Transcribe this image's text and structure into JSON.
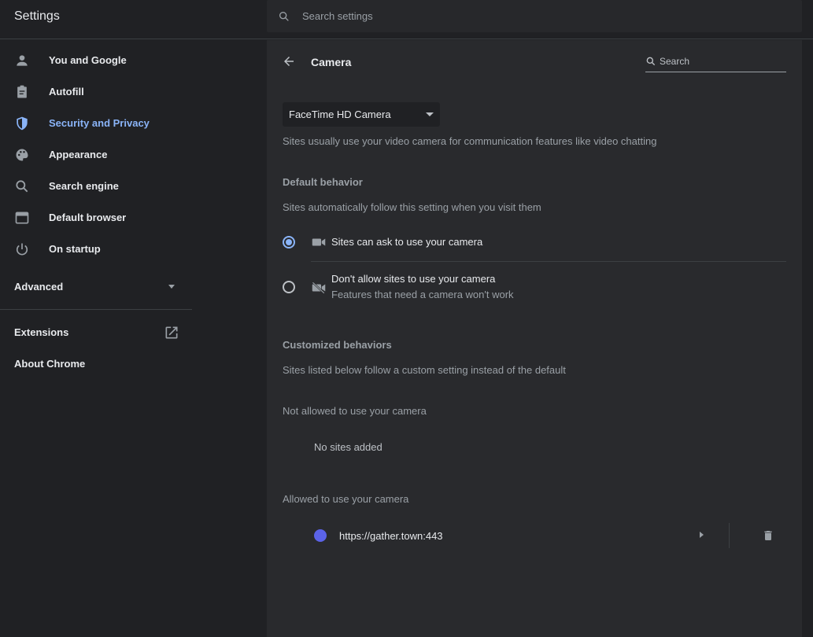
{
  "app": {
    "title": "Settings",
    "search_placeholder": "Search settings"
  },
  "sidebar": {
    "items": [
      {
        "label": "You and Google",
        "icon": "person-icon"
      },
      {
        "label": "Autofill",
        "icon": "clipboard-icon"
      },
      {
        "label": "Security and Privacy",
        "icon": "shield-icon",
        "active": true
      },
      {
        "label": "Appearance",
        "icon": "palette-icon"
      },
      {
        "label": "Search engine",
        "icon": "search-icon"
      },
      {
        "label": "Default browser",
        "icon": "browser-window-icon"
      },
      {
        "label": "On startup",
        "icon": "power-icon"
      }
    ],
    "advanced_label": "Advanced",
    "extensions_label": "Extensions",
    "about_label": "About Chrome"
  },
  "page": {
    "title": "Camera",
    "search_placeholder": "Search",
    "camera_select": "FaceTime HD Camera",
    "description": "Sites usually use your video camera for communication features like video chatting",
    "default_header": "Default behavior",
    "default_desc": "Sites automatically follow this setting when you visit them",
    "options": [
      {
        "label": "Sites can ask to use your camera",
        "selected": true
      },
      {
        "label": "Don't allow sites to use your camera",
        "sublabel": "Features that need a camera won't work",
        "selected": false
      }
    ],
    "custom_header": "Customized behaviors",
    "custom_desc": "Sites listed below follow a custom setting instead of the default",
    "not_allowed_header": "Not allowed to use your camera",
    "no_sites": "No sites added",
    "allowed_header": "Allowed to use your camera",
    "allowed_sites": [
      "https://gather.town:443"
    ]
  },
  "colors": {
    "accent": "#8ab4f8",
    "background": "#202124",
    "panel": "#292a2d"
  }
}
